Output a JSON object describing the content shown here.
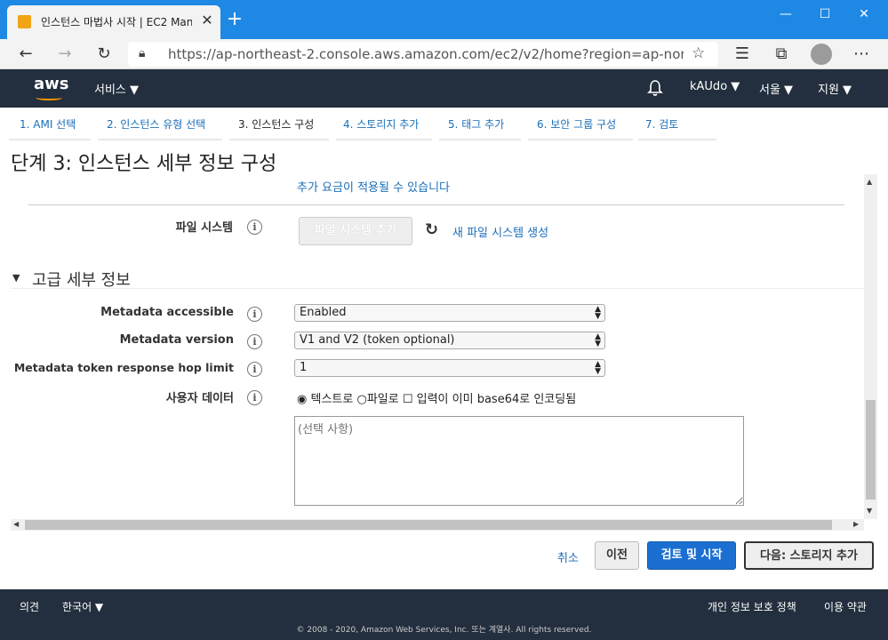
{
  "browser": {
    "tab_title": "인스턴스 마법사 시작 | EC2 Man",
    "url": "https://ap-northeast-2.console.aws.amazon.com/ec2/v2/home?region=ap-nort..."
  },
  "aws_header": {
    "logo": "aws",
    "services": "서비스 ▼",
    "account": "kAUdo ▼",
    "region": "서울 ▼",
    "support": "지원 ▼"
  },
  "steps": [
    {
      "label": "1. AMI 선택"
    },
    {
      "label": "2. 인스턴스 유형 선택"
    },
    {
      "label": "3. 인스턴스 구성"
    },
    {
      "label": "4. 스토리지 추가"
    },
    {
      "label": "5. 태그 추가"
    },
    {
      "label": "6. 보안 그룹 구성"
    },
    {
      "label": "7. 검토"
    }
  ],
  "page_title": "단계 3: 인스턴스 세부 정보 구성",
  "notice_link": "추가 요금이 적용될 수 있습니다",
  "filesystem": {
    "label": "파일 시스템",
    "add_button": "파일 시스템 추가",
    "create_link": "새 파일 시스템 생성"
  },
  "advanced": {
    "title": "고급 세부 정보",
    "metadata_accessible": {
      "label": "Metadata accessible",
      "value": "Enabled"
    },
    "metadata_version": {
      "label": "Metadata version",
      "value": "V1 and V2 (token optional)"
    },
    "hop_limit": {
      "label": "Metadata token response hop limit",
      "value": "1"
    },
    "user_data": {
      "label": "사용자 데이터",
      "option_text": "텍스트로",
      "option_file": "파일로",
      "option_base64": "입력이 이미 base64로 인코딩됨",
      "placeholder": "(선택 사항)"
    }
  },
  "actions": {
    "cancel": "취소",
    "previous": "이전",
    "review_launch": "검토 및 시작",
    "next": "다음: 스토리지 추가"
  },
  "footer": {
    "feedback": "의견",
    "language": "한국어 ▼",
    "privacy": "개인 정보 보호 정책",
    "terms": "이용 약관",
    "copyright": "© 2008 - 2020, Amazon Web Services, Inc. 또는 계열사. All rights reserved."
  }
}
